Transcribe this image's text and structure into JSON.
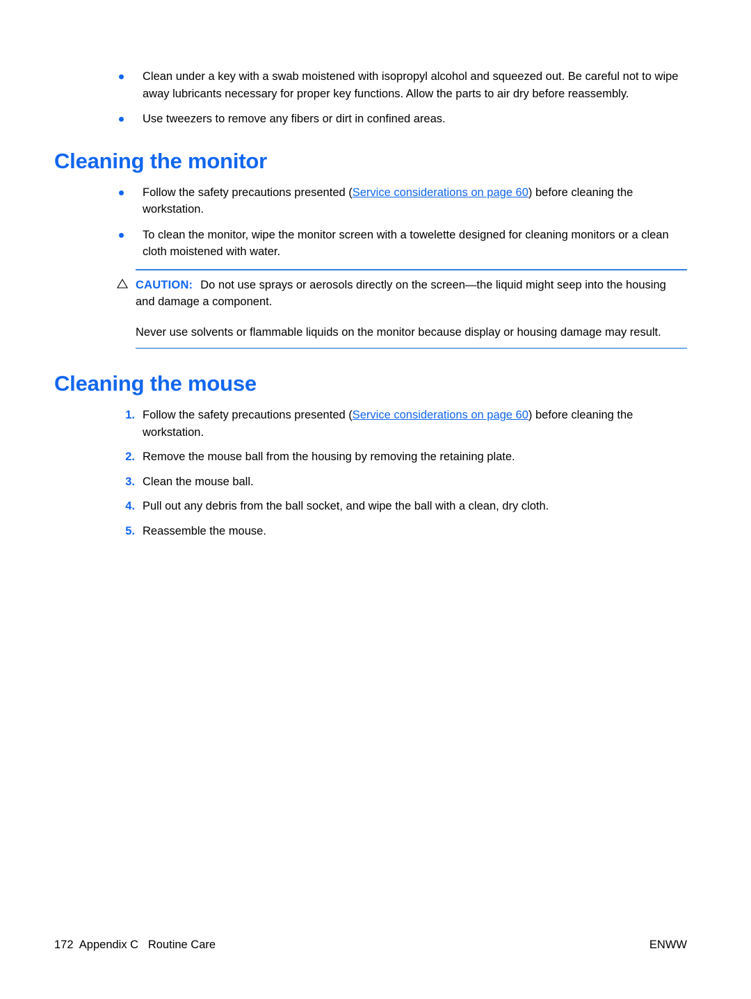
{
  "page": {
    "accent_blue": "#1166ee",
    "rule_top_color": "#2f7fe0",
    "rule_bottom_color": "#76aae4"
  },
  "intro_bullets": [
    "Clean under a key with a swab moistened with isopropyl alcohol and squeezed out. Be careful not to wipe away lubricants necessary for proper key functions. Allow the parts to air dry before reassembly.",
    "Use tweezers to remove any fibers or dirt in confined areas."
  ],
  "monitor_section": {
    "heading": "Cleaning the monitor",
    "bullet_1": {
      "before_link": "Follow the safety precautions presented (",
      "link": "Service considerations on page 60",
      "after_link": ") before cleaning the workstation."
    },
    "bullet_2": "To clean the monitor, wipe the monitor screen with a towelette designed for cleaning monitors or a clean cloth moistened with water.",
    "caution": {
      "icon": "warning-triangle-icon",
      "label": "CAUTION:",
      "paragraph_1": "Do not use sprays or aerosols directly on the screen—the liquid might seep into the housing and damage a component.",
      "paragraph_2": "Never use solvents or flammable liquids on the monitor because display or housing damage may result."
    }
  },
  "mouse_section": {
    "heading": "Cleaning the mouse",
    "steps": [
      {
        "number": "1.",
        "before_link": "Follow the safety precautions presented (",
        "link": "Service considerations on page 60",
        "after_link": ") before cleaning the workstation."
      },
      {
        "number": "2.",
        "text": "Remove the mouse ball from the housing by removing the retaining plate."
      },
      {
        "number": "3.",
        "text": "Clean the mouse ball."
      },
      {
        "number": "4.",
        "text": "Pull out any debris from the ball socket, and wipe the ball with a clean, dry cloth."
      },
      {
        "number": "5.",
        "text": "Reassemble the mouse."
      }
    ]
  },
  "footer": {
    "left": "172  Appendix C   Routine Care",
    "right": "ENWW"
  }
}
